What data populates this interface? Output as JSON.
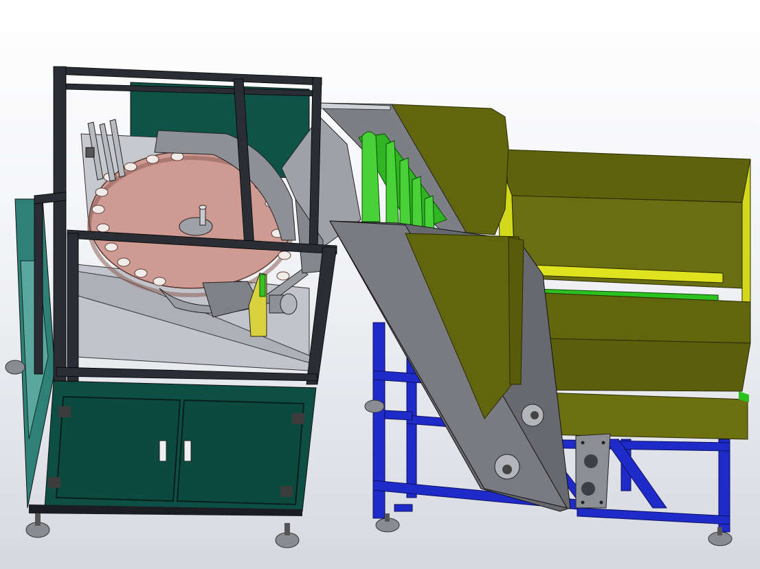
{
  "viewport": {
    "background_top": "#ffffff",
    "background_bottom": "#d7d9e0"
  },
  "colors": {
    "cabinet_panel": "#0d4f45",
    "cabinet_panel_light": "#1e7466",
    "cabinet_side": "#2b7d74",
    "frame_profile": "#2a2d33",
    "turntable_disc": "#cf9a92",
    "turntable_disc_shade": "#a97a73",
    "guide_wall": "#8a8c92",
    "guide_wall_light": "#b9bbc1",
    "chute_plate": "#6e7076",
    "chute_plate_light": "#a4a6ac",
    "hopper": "#60640e",
    "hopper_light": "#7a7f18",
    "hopper_yellow": "#d6da1a",
    "conveyor_green": "#27b81c",
    "conveyor_green_light": "#5fe04d",
    "stand_blue": "#1f2bc8",
    "stand_blue_dark": "#141c8a",
    "foot": "#6d6f74",
    "handle": "#f0f0f0"
  }
}
